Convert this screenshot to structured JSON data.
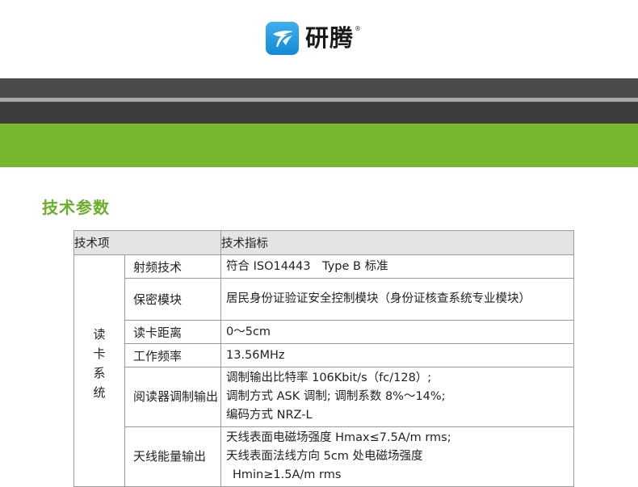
{
  "brand": {
    "name": "研腾",
    "registered": "®",
    "colors": {
      "logo_blue": "#1f97e0",
      "accent_green": "#76b72d",
      "title_green": "#6aae2a",
      "band_dark": "#3d3d3d"
    }
  },
  "section": {
    "title": "技术参数"
  },
  "table": {
    "headers": [
      "技术项",
      "技术指标"
    ],
    "category": "读卡系统",
    "rows": [
      {
        "name": "射频技术",
        "value": "符合 ISO14443　Type B 标准"
      },
      {
        "name": "保密模块",
        "value": "居民身份证验证安全控制模块（身份证核查系统专业模块）"
      },
      {
        "name": "读卡距离",
        "value": "0～5cm"
      },
      {
        "name": "工作频率",
        "value": "13.56MHz"
      },
      {
        "name": "阅读器调制输出",
        "value_lines": [
          "调制输出比特率 106Kbit/s（fc/128）;",
          "调制方式  ASK 调制; 调制系数 8%～14%;",
          "编码方式  NRZ-L"
        ]
      },
      {
        "name": "天线能量输出",
        "value_lines": [
          "天线表面电磁场强度  Hmax≤7.5A/m rms;",
          "天线表面法线方向 5cm 处电磁场强度",
          "Hmin≥1.5A/m rms"
        ]
      }
    ]
  }
}
